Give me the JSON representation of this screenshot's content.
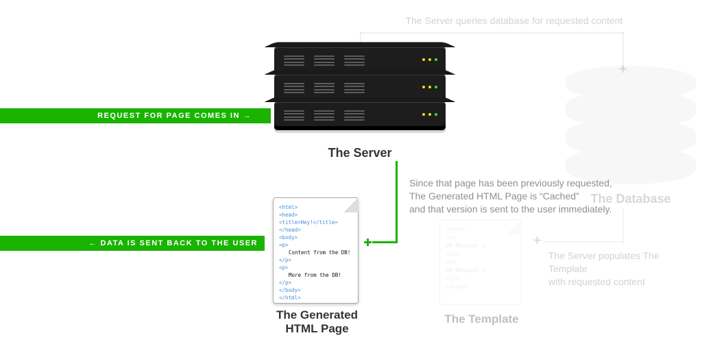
{
  "labels": {
    "server": "The Server",
    "database": "The Database",
    "template": "The Template",
    "generated": "The Generated\nHTML Page"
  },
  "bars": {
    "request": "REQUEST FOR PAGE COMES IN  →",
    "response": "←  DATA IS SENT BACK TO THE USER"
  },
  "captions": {
    "top": "The Server queries database for requested content",
    "cache": "Since that page has been previously requested,\nThe Generated HTML Page is “Cached”\nand that version is sent to the user immediately.",
    "populate": "The Server populates The Template\nwith requested content"
  },
  "files": {
    "template": {
      "lines": [
        "<body>",
        "  <p>",
        "   DB Request 1",
        "  </p>",
        "  <p>",
        "   DB Request 2",
        "  </p>",
        "</body>"
      ]
    },
    "generated": {
      "lines": [
        "<html>",
        " <head>",
        "  <title>Hey!</title>",
        " </head>",
        " <body>",
        "  <p>",
        "   Content from the DB!",
        "  </p>",
        "  <p>",
        "   More from the DB!",
        "  </p>",
        " </body>",
        "</html>"
      ]
    }
  }
}
